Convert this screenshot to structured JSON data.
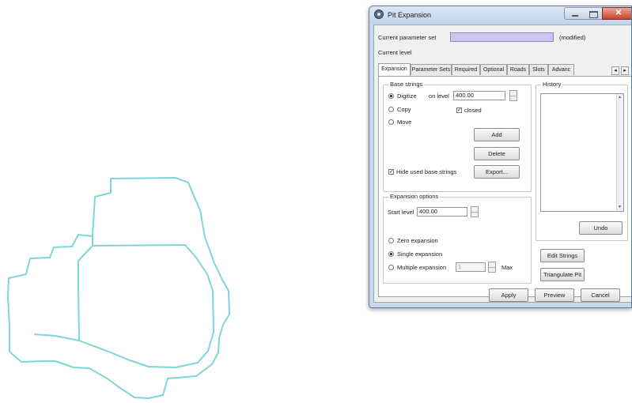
{
  "window": {
    "title": "Pit Expansion",
    "close_glyph": "✕"
  },
  "header": {
    "current_parameter_set_label": "Current parameter set",
    "current_parameter_set_value": "",
    "modified_label": "(modified)",
    "current_level_label": "Current level"
  },
  "tabs": [
    {
      "label": "Expansion",
      "active": true
    },
    {
      "label": "Parameter Sets",
      "active": false
    },
    {
      "label": "Required",
      "active": false
    },
    {
      "label": "Optional",
      "active": false
    },
    {
      "label": "Roads",
      "active": false
    },
    {
      "label": "Slots",
      "active": false
    },
    {
      "label": "Advanc",
      "active": false
    }
  ],
  "tab_scroll": {
    "left": "◂",
    "right": "▸"
  },
  "base_strings": {
    "title": "Base strings",
    "digitize_label": "Digitize",
    "copy_label": "Copy",
    "move_label": "Move",
    "selected_mode": "Digitize",
    "on_level_label": "on level",
    "on_level_value": "400.00",
    "closed_label": "closed",
    "closed_checked": true,
    "add_label": "Add",
    "delete_label": "Delete",
    "hide_used_label": "Hide used base strings",
    "hide_used_checked": true,
    "export_label": "Export..."
  },
  "history": {
    "title": "History",
    "undo_label": "Undo"
  },
  "expansion_options": {
    "title": "Expansion options",
    "start_level_label": "Start level",
    "start_level_value": "400.00",
    "zero_label": "Zero expansion",
    "single_label": "Single expansion",
    "multiple_label": "Multiple expansion",
    "multiple_value": "1",
    "max_label": "Max",
    "selected": "Single expansion"
  },
  "side_buttons": {
    "edit_strings": "Edit Strings",
    "triangulate_pit": "Triangulate Pit"
  },
  "footer": {
    "apply": "Apply",
    "preview": "Preview",
    "cancel": "Cancel"
  },
  "colors": {
    "pit_outline": "#7fd6d6",
    "parameter_set_field": "#c9c6f0",
    "title_bar": "#c9d9ec",
    "close_button": "#c8432f"
  },
  "icons": {
    "app": "pit-expansion-icon",
    "check": "checkmark-icon"
  }
}
